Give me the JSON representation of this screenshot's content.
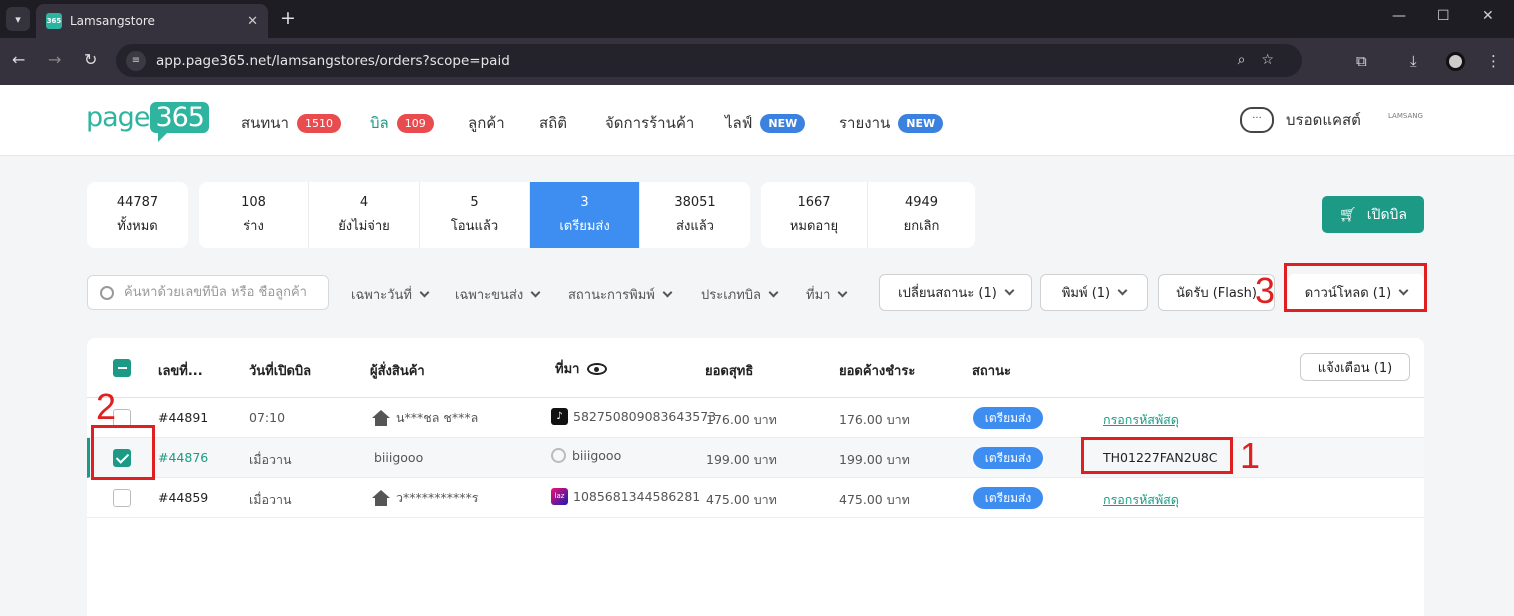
{
  "browser": {
    "tab_title": "Lamsangstore",
    "favicon_text": "365",
    "url": "app.page365.net/lamsangstores/orders?scope=paid"
  },
  "header": {
    "logo_text": "page",
    "logo_num": "365",
    "menu": [
      {
        "label": "สนทนา",
        "badge": "1510",
        "badge_type": "red"
      },
      {
        "label": "บิล",
        "badge": "109",
        "badge_type": "red"
      },
      {
        "label": "ลูกค้า"
      },
      {
        "label": "สถิติ"
      },
      {
        "label": "จัดการร้านค้า"
      },
      {
        "label": "ไลฟ์",
        "badge": "NEW",
        "badge_type": "blue"
      },
      {
        "label": "รายงาน",
        "badge": "NEW",
        "badge_type": "blue"
      }
    ],
    "broadcast_label": "บรอดแคสต์",
    "brand_logo_text": "LAMSANG"
  },
  "scopes": [
    {
      "count": "44787",
      "label": "ทั้งหมด"
    },
    {
      "count": "108",
      "label": "ร่าง"
    },
    {
      "count": "4",
      "label": "ยังไม่จ่าย"
    },
    {
      "count": "5",
      "label": "โอนแล้ว"
    },
    {
      "count": "3",
      "label": "เตรียมส่ง"
    },
    {
      "count": "38051",
      "label": "ส่งแล้ว"
    },
    {
      "count": "1667",
      "label": "หมดอายุ"
    },
    {
      "count": "4949",
      "label": "ยกเลิก"
    }
  ],
  "open_bill_label": "เปิดบิล",
  "filters": {
    "search_placeholder": "ค้นหาด้วยเลขที่บิล หรือ ชื่อลูกค้า",
    "dropdowns": [
      "เฉพาะวันที่",
      "เฉพาะขนส่ง",
      "สถานะการพิมพ์",
      "ประเภทบิล",
      "ที่มา"
    ],
    "change_status": "เปลี่ยนสถานะ (1)",
    "print": "พิมพ์ (1)",
    "pickup": "นัดรับ (Flash)",
    "download": "ดาวน์โหลด (1)"
  },
  "table": {
    "columns": [
      "เลขที่...",
      "วันที่เปิดบิล",
      "ผู้สั่งสินค้า",
      "ที่มา",
      "ยอดสุทธิ",
      "ยอดค้างชำระ",
      "สถานะ"
    ],
    "notify_label": "แจ้งเตือน (1)",
    "rows": [
      {
        "id": "#44891",
        "date": "07:10",
        "customer": "น***ชล ช***ล",
        "source": "582750809083643573",
        "net": "176.00 บาท",
        "due": "176.00 บาท",
        "status": "เตรียมส่ง",
        "tracking": "กรอกรหัสพัสดุ",
        "checked": false,
        "source_icon": "tiktok-icon"
      },
      {
        "id": "#44876",
        "date": "เมื่อวาน",
        "customer": "biiigooo",
        "source": "biiigooo",
        "net": "199.00 บาท",
        "due": "199.00 บาท",
        "status": "เตรียมส่ง",
        "tracking": "TH01227FAN2U8C",
        "checked": true,
        "source_icon": "line-icon"
      },
      {
        "id": "#44859",
        "date": "เมื่อวาน",
        "customer": "ว***********ร",
        "source": "1085681344586281",
        "net": "475.00 บาท",
        "due": "475.00 บาท",
        "status": "เตรียมส่ง",
        "tracking": "กรอกรหัสพัสดุ",
        "checked": false,
        "source_icon": "lazada-icon"
      }
    ]
  },
  "annotations": {
    "n1": "1",
    "n2": "2",
    "n3": "3"
  },
  "colors": {
    "accent": "#1c9a86",
    "active_tab": "#3d8ef0",
    "badge_red": "#e84c4f",
    "annotation": "#e02020"
  }
}
